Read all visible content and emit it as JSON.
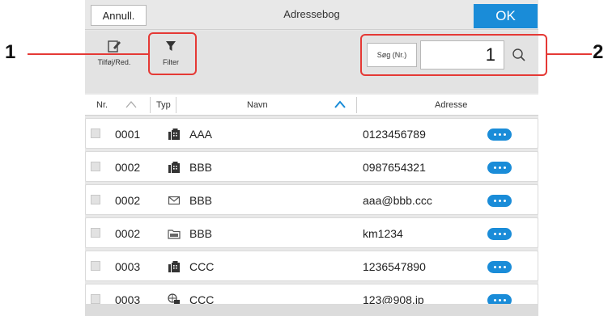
{
  "header": {
    "cancel_label": "Annull.",
    "title": "Adressebog",
    "ok_label": "OK"
  },
  "toolbar": {
    "edit_label": "Tilføj/Red.",
    "filter_label": "Filter",
    "search_label": "Søg (Nr.)",
    "search_value": "1"
  },
  "table": {
    "columns": {
      "nr": "Nr.",
      "typ": "Typ",
      "navn": "Navn",
      "adresse": "Adresse"
    },
    "rows": [
      {
        "nr": "0001",
        "type_icon": "fax-icon",
        "navn": "AAA",
        "adresse": "0123456789"
      },
      {
        "nr": "0002",
        "type_icon": "fax-icon",
        "navn": "BBB",
        "adresse": "0987654321"
      },
      {
        "nr": "0002",
        "type_icon": "email-icon",
        "navn": "BBB",
        "adresse": "aaa@bbb.ccc"
      },
      {
        "nr": "0002",
        "type_icon": "smb-folder-icon",
        "navn": "BBB",
        "adresse": "km1234"
      },
      {
        "nr": "0003",
        "type_icon": "fax-icon",
        "navn": "CCC",
        "adresse": "1236547890"
      },
      {
        "nr": "0003",
        "type_icon": "ifax-icon",
        "navn": "CCC",
        "adresse": "123@908.jp"
      }
    ]
  },
  "callouts": {
    "one": "1",
    "two": "2"
  },
  "colors": {
    "accent": "#1a8cd8",
    "callout": "#e53935"
  }
}
